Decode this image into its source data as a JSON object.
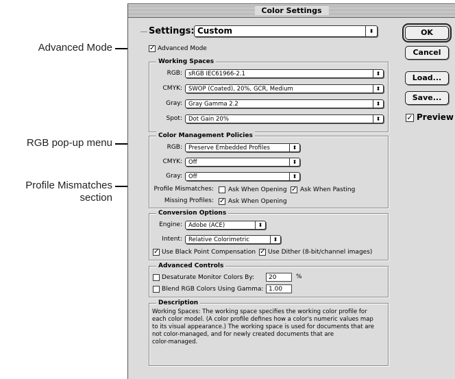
{
  "callouts": {
    "advanced_mode": "Advanced Mode",
    "rgb_popup": "RGB pop-up menu",
    "profile_mismatches_line1": "Profile Mismatches",
    "profile_mismatches_line2": "section"
  },
  "window": {
    "title": "Color Settings"
  },
  "settings": {
    "label": "Settings:",
    "value": "Custom"
  },
  "advanced_mode": {
    "label": "Advanced Mode",
    "checked": true
  },
  "buttons": {
    "ok": "OK",
    "cancel": "Cancel",
    "load": "Load...",
    "save": "Save..."
  },
  "preview": {
    "label": "Preview",
    "checked": true
  },
  "working_spaces": {
    "title": "Working Spaces",
    "rgb_label": "RGB:",
    "rgb_value": "sRGB IEC61966-2.1",
    "cmyk_label": "CMYK:",
    "cmyk_value": "SWOP (Coated), 20%, GCR, Medium",
    "gray_label": "Gray:",
    "gray_value": "Gray Gamma 2.2",
    "spot_label": "Spot:",
    "spot_value": "Dot Gain 20%"
  },
  "policies": {
    "title": "Color Management Policies",
    "rgb_label": "RGB:",
    "rgb_value": "Preserve Embedded Profiles",
    "cmyk_label": "CMYK:",
    "cmyk_value": "Off",
    "gray_label": "Gray:",
    "gray_value": "Off",
    "mismatch_label": "Profile Mismatches:",
    "ask_opening": "Ask When Opening",
    "ask_opening_checked": false,
    "ask_pasting": "Ask When Pasting",
    "ask_pasting_checked": true,
    "missing_label": "Missing Profiles:",
    "missing_ask_opening": "Ask When Opening",
    "missing_ask_opening_checked": true
  },
  "conversion": {
    "title": "Conversion Options",
    "engine_label": "Engine:",
    "engine_value": "Adobe (ACE)",
    "intent_label": "Intent:",
    "intent_value": "Relative Colorimetric",
    "bpc": "Use Black Point Compensation",
    "bpc_checked": true,
    "dither": "Use Dither (8-bit/channel images)",
    "dither_checked": true
  },
  "advanced_controls": {
    "title": "Advanced Controls",
    "desaturate": "Desaturate Monitor Colors By:",
    "desaturate_value": "20",
    "desaturate_unit": "%",
    "blend": "Blend RGB Colors Using Gamma:",
    "blend_value": "1.00"
  },
  "description": {
    "title": "Description",
    "lines": [
      "Working Spaces:  The working space specifies the working color profile for",
      "each color model.  (A color profile defines how a color's numeric values map",
      "to its visual appearance.)  The working space is used for documents that are",
      "not color-managed, and for newly created documents that are",
      "color-managed."
    ]
  }
}
